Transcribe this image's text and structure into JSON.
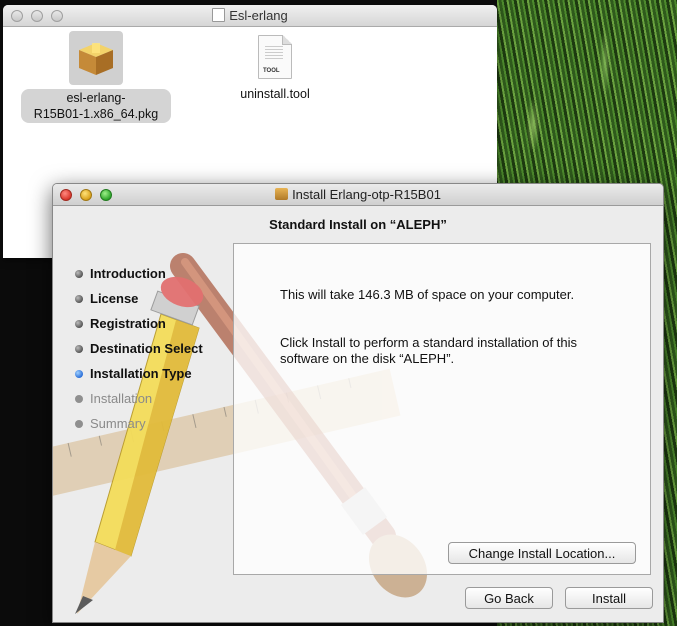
{
  "finder": {
    "title": "Esl-erlang",
    "files": [
      {
        "label_line1": "esl-erlang-",
        "label_line2": "R15B01-1.x86_64.pkg",
        "icon": "package-icon"
      },
      {
        "label": "uninstall.tool",
        "icon": "tool-file-icon"
      }
    ]
  },
  "installer": {
    "title": "Install Erlang-otp-R15B01",
    "header": "Standard Install on “ALEPH”",
    "steps": [
      {
        "label": "Introduction",
        "state": "done"
      },
      {
        "label": "License",
        "state": "done"
      },
      {
        "label": "Registration",
        "state": "done"
      },
      {
        "label": "Destination Select",
        "state": "done"
      },
      {
        "label": "Installation Type",
        "state": "active"
      },
      {
        "label": "Installation",
        "state": "pending"
      },
      {
        "label": "Summary",
        "state": "pending"
      }
    ],
    "message1": "This will take 146.3 MB of space on your computer.",
    "message2": "Click Install to perform a standard installation of this software on the disk “ALEPH”.",
    "change_location_label": "Change Install Location...",
    "go_back_label": "Go Back",
    "install_label": "Install"
  },
  "colors": {
    "active_step": "#2a6ed8",
    "close": "#d9362b",
    "minimize": "#d9a11b",
    "zoom": "#2ea52a"
  }
}
